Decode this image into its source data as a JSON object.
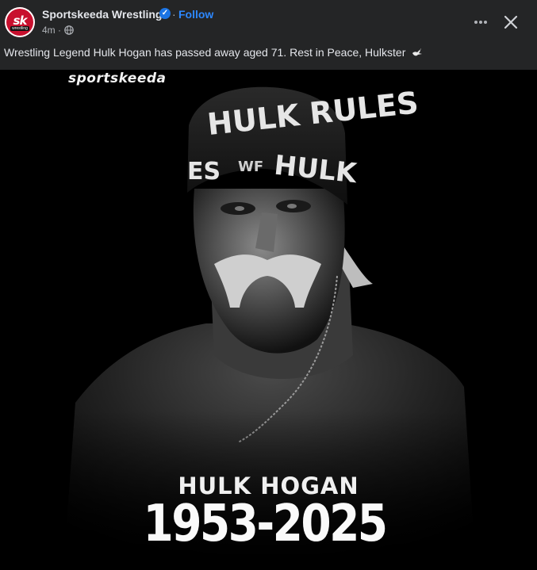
{
  "post": {
    "page_name": "Sportskeeda Wrestling",
    "separator": "·",
    "follow_label": "Follow",
    "time": "4m",
    "time_separator": "·",
    "caption": "Wrestling Legend Hulk Hogan has passed away aged 71. Rest in Peace, Hulkster",
    "avatar_text": "sk",
    "avatar_sub": "wrestling"
  },
  "image": {
    "brand": "sportskeeda",
    "headband_text_1": "HULK RULES",
    "headband_text_2": "WF",
    "headband_text_3": "ES",
    "headband_text_4": "HULK",
    "name": "HULK HOGAN",
    "years": "1953-2025"
  },
  "icons": {
    "verified": "verified-badge-icon",
    "audience": "globe-icon",
    "more": "more-options-icon",
    "close": "close-icon",
    "dove": "dove-icon"
  },
  "colors": {
    "background": "#242526",
    "text": "#e4e6eb",
    "secondary_text": "#b0b3b8",
    "follow": "#2d88ff",
    "verified": "#1b74e4",
    "brand_red": "#c8102e"
  }
}
